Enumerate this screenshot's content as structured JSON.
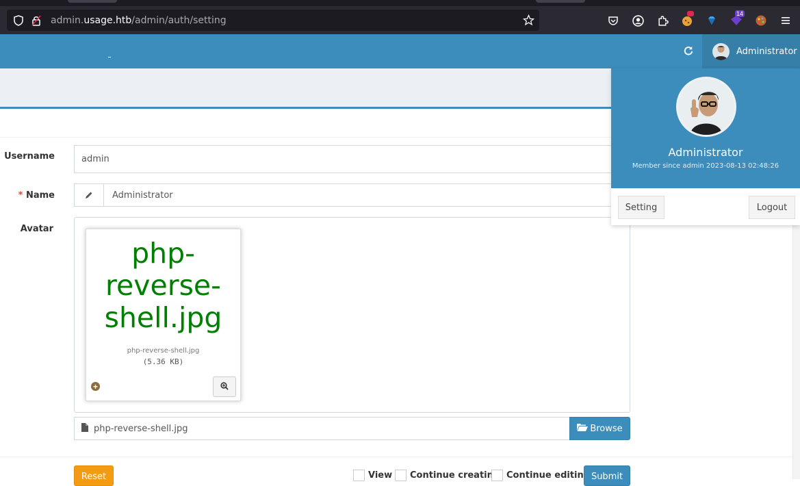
{
  "browser": {
    "url_prefix": "admin.",
    "url_domain": "usage.htb",
    "url_path": "/admin/auth/setting",
    "extension_badge": "14"
  },
  "header": {
    "user_name": "Administrator"
  },
  "user_dropdown": {
    "name": "Administrator",
    "member_since": "Member since admin 2023-08-13 02:48:26",
    "setting_label": "Setting",
    "logout_label": "Logout"
  },
  "form": {
    "username_label": "Username",
    "username_value": "admin",
    "name_required_mark": "*",
    "name_label": "Name",
    "name_value": "Administrator",
    "avatar_label": "Avatar",
    "preview": {
      "caption": "php-reverse-shell.jpg",
      "file_name": "php-reverse-shell.jpg",
      "file_size": "(5.36 KB)"
    },
    "file_input_value": "php-reverse-shell.jpg",
    "browse_label": "Browse"
  },
  "footer": {
    "reset_label": "Reset",
    "view_label": "View",
    "continue_creating_label": "Continue creating",
    "continue_editing_label": "Continue editing",
    "submit_label": "Submit"
  },
  "colors": {
    "primary": "#3c8dbc",
    "primary_dark": "#367fa9",
    "warning": "#f39c12",
    "preview_text": "#008000"
  }
}
